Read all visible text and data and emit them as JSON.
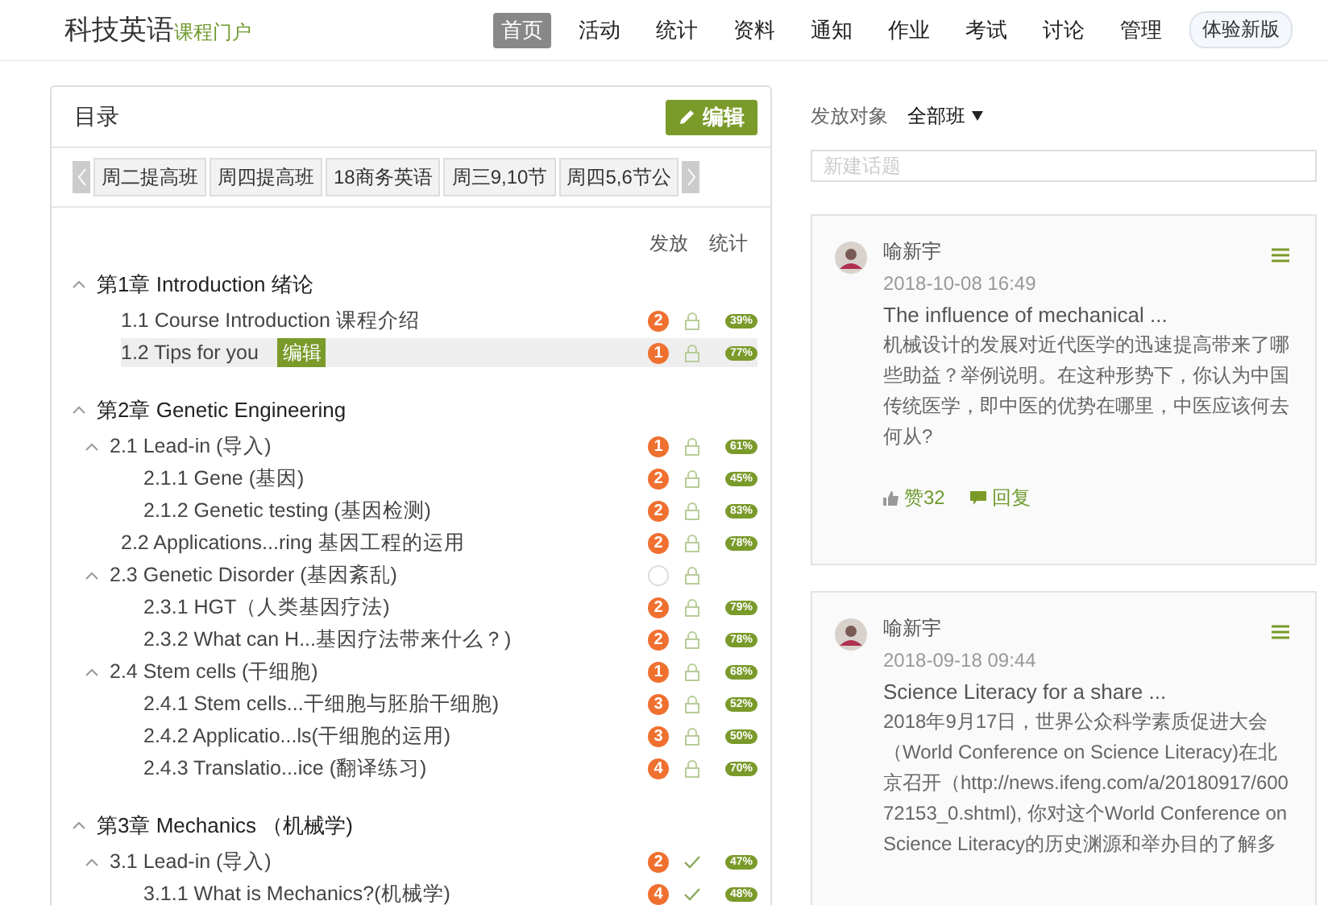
{
  "header": {
    "title": "科技英语",
    "subtitle": "课程门户",
    "nav": [
      {
        "label": "首页",
        "selected": true
      },
      {
        "label": "活动",
        "selected": false
      },
      {
        "label": "统计",
        "selected": false
      },
      {
        "label": "资料",
        "selected": false
      },
      {
        "label": "通知",
        "selected": false
      },
      {
        "label": "作业",
        "selected": false
      },
      {
        "label": "考试",
        "selected": false
      },
      {
        "label": "讨论",
        "selected": false
      },
      {
        "label": "管理",
        "selected": false
      }
    ],
    "new_version_button": "体验新版"
  },
  "catalog": {
    "title": "目录",
    "edit_button": "编辑",
    "tabs": [
      "周二提高班",
      "周四提高班",
      "18商务英语",
      "周三9,10节",
      "周四5,6节公"
    ],
    "columns": [
      "发放",
      "统计"
    ],
    "chapters": [
      {
        "title": "第1章 Introduction 绪论",
        "expanded": true,
        "children": [
          {
            "title": "1.1  Course Introduction 课程介绍",
            "badge": "2",
            "published": false,
            "stat": "39%",
            "selected": false
          },
          {
            "title": "1.2  Tips for you",
            "edit_tag": "编辑",
            "badge": "1",
            "published": false,
            "stat": "77%",
            "selected": true
          }
        ]
      },
      {
        "title": "第2章 Genetic Engineering",
        "expanded": true,
        "children": [
          {
            "title": "2.1  Lead-in (导入)",
            "expanded": true,
            "badge": "1",
            "published": false,
            "stat": "61%",
            "selected": false,
            "children": [
              {
                "title": "2.1.1 Gene (基因)",
                "badge": "2",
                "published": false,
                "stat": "45%",
                "selected": false
              },
              {
                "title": "2.1.2 Genetic testing (基因检测)",
                "badge": "2",
                "published": false,
                "stat": "83%",
                "selected": false
              }
            ]
          },
          {
            "title": "2.2  Applications...ring 基因工程的运用",
            "badge": "2",
            "published": false,
            "stat": "78%",
            "selected": false
          },
          {
            "title": "2.3  Genetic Disorder (基因紊乱)",
            "expanded": true,
            "published": false,
            "selected": false,
            "children": [
              {
                "title": "2.3.1 HGT（人类基因疗法)",
                "badge": "2",
                "published": false,
                "stat": "79%",
                "selected": false
              },
              {
                "title": "2.3.2 What can H...基因疗法带来什么？)",
                "badge": "2",
                "published": false,
                "stat": "78%",
                "selected": false
              }
            ]
          },
          {
            "title": "2.4  Stem cells (干细胞)",
            "expanded": true,
            "badge": "1",
            "published": false,
            "stat": "68%",
            "selected": false,
            "children": [
              {
                "title": "2.4.1 Stem cells...干细胞与胚胎干细胞)",
                "badge": "3",
                "published": false,
                "stat": "52%",
                "selected": false
              },
              {
                "title": "2.4.2 Applicatio...ls(干细胞的运用)",
                "badge": "3",
                "published": false,
                "stat": "50%",
                "selected": false
              },
              {
                "title": "2.4.3 Translatio...ice (翻译练习)",
                "badge": "4",
                "published": false,
                "stat": "70%",
                "selected": false
              }
            ]
          }
        ]
      },
      {
        "title": "第3章 Mechanics （机械学)",
        "expanded": true,
        "children": [
          {
            "title": "3.1  Lead-in (导入)",
            "expanded": true,
            "badge": "2",
            "published": true,
            "stat": "47%",
            "selected": false,
            "children": [
              {
                "title": "3.1.1 What is Mechanics?(机械学)",
                "badge": "4",
                "published": true,
                "stat": "48%",
                "selected": false
              }
            ]
          }
        ]
      }
    ]
  },
  "discussion": {
    "audience_label": "发放对象",
    "audience_value": "全部班",
    "topic_placeholder": "新建话题",
    "posts": [
      {
        "author": "喻新宇",
        "time": "2018-10-08 16:49",
        "title": "The influence of mechanical ...",
        "body": "机械设计的发展对近代医学的迅速提高带来了哪些助益？举例说明。在这种形势下，你认为中国传统医学，即中医的优势在哪里，中医应该何去何从?",
        "likes": "赞32",
        "reply": "回复"
      },
      {
        "author": "喻新宇",
        "time": "2018-09-18 09:44",
        "title": "Science Literacy for a share ...",
        "body": "2018年9月17日，世界公众科学素质促进大会（World Conference on Science Literacy)在北京召开（http://news.ifeng.com/a/20180917/60072153_0.shtml), 你对这个World Conference on Science Literacy的历史渊源和举办目的了解多"
      }
    ]
  }
}
